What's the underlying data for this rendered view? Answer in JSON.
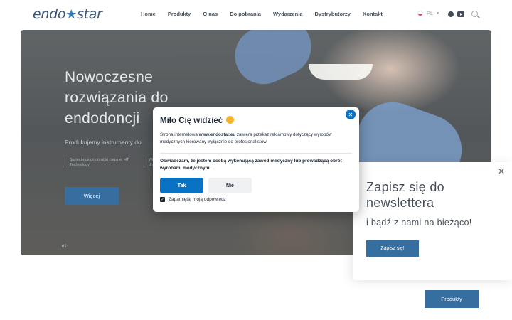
{
  "header": {
    "logo_left": "endo",
    "logo_star": "★",
    "logo_right": "star",
    "nav": [
      "Home",
      "Produkty",
      "O nas",
      "Do pobrania",
      "Wydarzenia",
      "Dystrybutorzy",
      "Kontakt"
    ],
    "language": "PL",
    "icons": [
      "flag-pl-icon",
      "chevron-down-icon",
      "facebook-icon",
      "youtube-icon",
      "search-icon"
    ]
  },
  "hero": {
    "title": "Nowoczesne rozwiązania do endodoncji",
    "subtitle": "Produkujemy instrumenty do",
    "feature1": "Są technologii obróbki cieplnej HT Technology",
    "feature2": "Wła dra",
    "button": "Więcej",
    "slide_number": "01"
  },
  "products_button": "Produkty",
  "newsletter": {
    "title": "Zapisz się do newslettera",
    "subtitle": "i bądź z nami na bieżąco!",
    "button": "Zapisz się!",
    "close": "✕"
  },
  "modal": {
    "title": "Miło Cię widzieć",
    "text_before": "Strona internetowa ",
    "url": "www.endostar.eu",
    "text_after": " zawiera przekaz reklamowy dotyczący wyrobów medycznych kierowany wyłącznie do profesjonalistów.",
    "declaration": "Oświadczam, że jestem osobą wykonującą zawód medyczny lub prowadzącą obrót wyrobami medycznymi.",
    "yes_button": "Tak",
    "no_button": "Nie",
    "remember": "Zapamiętaj moją odpowiedź",
    "remember_checked": true,
    "close": "✕"
  },
  "colors": {
    "brand_blue": "#0b4f8c",
    "modal_blue": "#0a72c2",
    "text_dark": "#1c2733"
  }
}
